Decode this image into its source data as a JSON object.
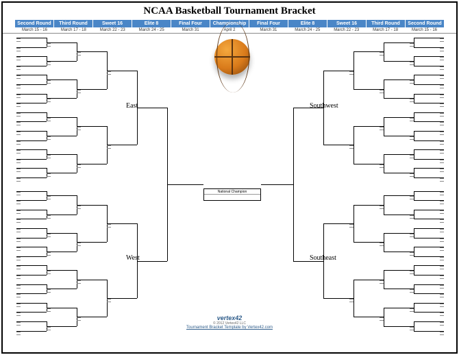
{
  "title": "NCAA Basketball Tournament Bracket",
  "columns": {
    "left": [
      {
        "label": "Second Round",
        "date": "March 15 - 16"
      },
      {
        "label": "Third Round",
        "date": "March 17 - 18"
      },
      {
        "label": "Sweet 16",
        "date": "March 22 - 23"
      },
      {
        "label": "Elite 8",
        "date": "March 24 - 25"
      },
      {
        "label": "Final Four",
        "date": "March 31"
      }
    ],
    "center": {
      "label": "Championship",
      "date": "April 2"
    },
    "right": [
      {
        "label": "Final Four",
        "date": "March 31"
      },
      {
        "label": "Elite 8",
        "date": "March 24 - 25"
      },
      {
        "label": "Sweet 16",
        "date": "March 22 - 23"
      },
      {
        "label": "Third Round",
        "date": "March 17 - 18"
      },
      {
        "label": "Second Round",
        "date": "March 15 - 16"
      }
    ]
  },
  "regions": {
    "top_left": "East",
    "bottom_left": "West",
    "top_right": "Southwest",
    "bottom_right": "Southeast"
  },
  "champion_label": "National Champion",
  "footer": {
    "brand": "vertex42",
    "copy": "© 2012 Vertex42 LLC",
    "link": "Tournament Bracket Template by Vertex42.com"
  },
  "chart_data": {
    "type": "table",
    "structure": "single-elimination-bracket",
    "teams_per_region": 16,
    "regions": [
      "East",
      "West",
      "Southwest",
      "Southeast"
    ],
    "rounds": [
      "Second Round",
      "Third Round",
      "Sweet 16",
      "Elite 8",
      "Final Four",
      "Championship"
    ],
    "round_dates": {
      "Second Round": "March 15 - 16",
      "Third Round": "March 17 - 18",
      "Sweet 16": "March 22 - 23",
      "Elite 8": "March 24 - 25",
      "Final Four": "March 31",
      "Championship": "April 2"
    },
    "slots_filled": false
  }
}
